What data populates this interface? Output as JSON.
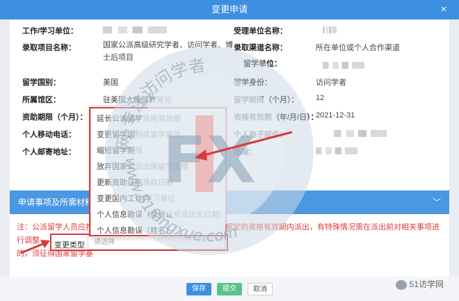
{
  "window": {
    "title": "变更申请",
    "close_label": "×"
  },
  "info": {
    "work_unit_label": "工作/学习单位：",
    "receiving_unit_label": "受理单位名称：",
    "project_label": "录取项目名称：",
    "project_value": "国家公派高级研究学者、访问学者、博士后项目",
    "channel_label": "录取渠道名称：",
    "channel_value": "所在单位或个人合作渠道",
    "study_unit_label": "留学单位：",
    "country_label": "留学国别：",
    "country_value": "美国",
    "status_label": "留学身份：",
    "status_value": "访问学者",
    "embassy_label": "所属馆区：",
    "embassy_value": "驻美国大使馆教育处",
    "period_label": "留学期限（个月）：",
    "period_value": "12",
    "funding_label": "资助期限（个月）：",
    "qualification_label": "资格有效期（年/月/日）：",
    "qualification_value": "2021-12-31",
    "mobile_label": "个人移动电话：",
    "email_label": "个人电子邮件：",
    "address_label": "个人邮寄地址：",
    "zip_label": "邮编："
  },
  "section": {
    "title": "申请事项及所需材料",
    "chevron": "﹀"
  },
  "note": {
    "text": "注：公派留学人员应按照国家留学基金委规定的资格有效期内派出……规定的资格有效期内派出，有特殊情况需在派出前对相关事项进行调整的，须征得国家留学基金委同意。",
    "line1": "注：公派留学人员应按",
    "line1_tail": "规定的资格有效期内派出，有特殊情况需在派出前对相关事项进行调整",
    "line2": "的，须征得国家留学基"
  },
  "change_type": {
    "label": "变更类型",
    "placeholder": "请选择"
  },
  "dropdown": {
    "options": [
      "延长公派留学资格有效期",
      "变更留学国别或留学单位",
      "缩短留学期限",
      "放弃国家公派出国留学资格",
      "更新资助证明落款日期",
      "变更国内工作/学习单位",
      "个人信息勘误（身份证号或出生日期）",
      "个人信息勘误（姓名）"
    ]
  },
  "footer": {
    "save": "保存",
    "submit": "提交",
    "cancel": "取消"
  },
  "watermark": {
    "brand": "51访学网",
    "ring_text": "网·专注访问学者",
    "url": "www.51fangxue.com",
    "logo_text": "FX"
  },
  "colors": {
    "primary": "#3d8fe0",
    "submit": "#5bc28a",
    "alert": "#d63a3a"
  }
}
